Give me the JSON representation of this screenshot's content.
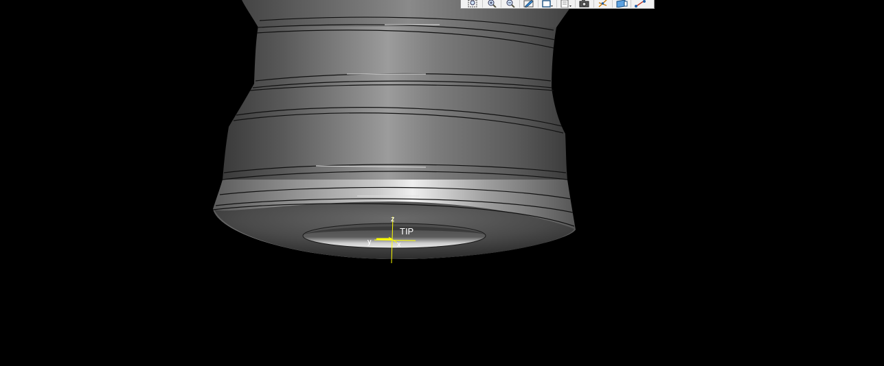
{
  "toolbar": {
    "buttons": [
      {
        "icon": "zoom-window-icon"
      },
      {
        "icon": "zoom-in-icon"
      },
      {
        "icon": "zoom-out-icon"
      },
      {
        "icon": "shading-icon"
      },
      {
        "icon": "view-orientation-icon"
      },
      {
        "icon": "saved-views-icon"
      },
      {
        "icon": "camera-icon"
      },
      {
        "icon": "spin-center-icon"
      },
      {
        "icon": "datum-display-icon"
      },
      {
        "icon": "sketch-curve-icon"
      }
    ]
  },
  "triad": {
    "csys_label": "TIP",
    "z_label": "z",
    "y_label": "y",
    "x_label": "x",
    "color": "#ffff00"
  },
  "model": {
    "background": "#000000",
    "edge_color": "#111111"
  }
}
